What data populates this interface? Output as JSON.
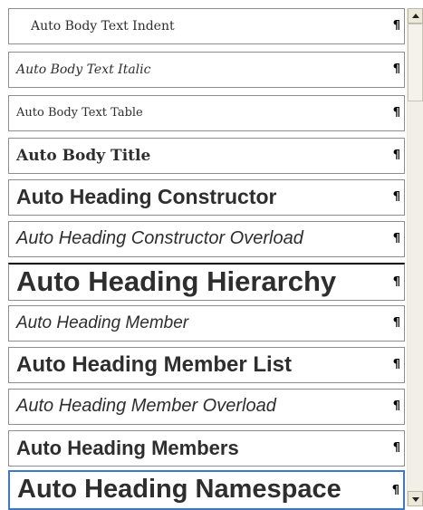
{
  "styles_list": {
    "items": [
      {
        "label": "Auto Body Text Indent",
        "mark": "¶"
      },
      {
        "label": "Auto Body Text Italic",
        "mark": "¶"
      },
      {
        "label": "Auto Body Text Table",
        "mark": "¶"
      },
      {
        "label": "Auto Body Title",
        "mark": "¶"
      },
      {
        "label": "Auto Heading Constructor",
        "mark": "¶"
      },
      {
        "label": "Auto Heading Constructor Overload",
        "mark": "¶"
      },
      {
        "label": "Auto Heading Hierarchy",
        "mark": "¶"
      },
      {
        "label": "Auto Heading Member",
        "mark": "¶"
      },
      {
        "label": "Auto Heading Member List",
        "mark": "¶"
      },
      {
        "label": "Auto Heading Member Overload",
        "mark": "¶"
      },
      {
        "label": "Auto Heading Members",
        "mark": "¶"
      },
      {
        "label": "Auto Heading Namespace",
        "mark": "¶"
      }
    ],
    "selected_label": "Auto Heading Namespace"
  },
  "colors": {
    "selection_border": "#3f78c7",
    "item_border": "#8e8e8e"
  }
}
